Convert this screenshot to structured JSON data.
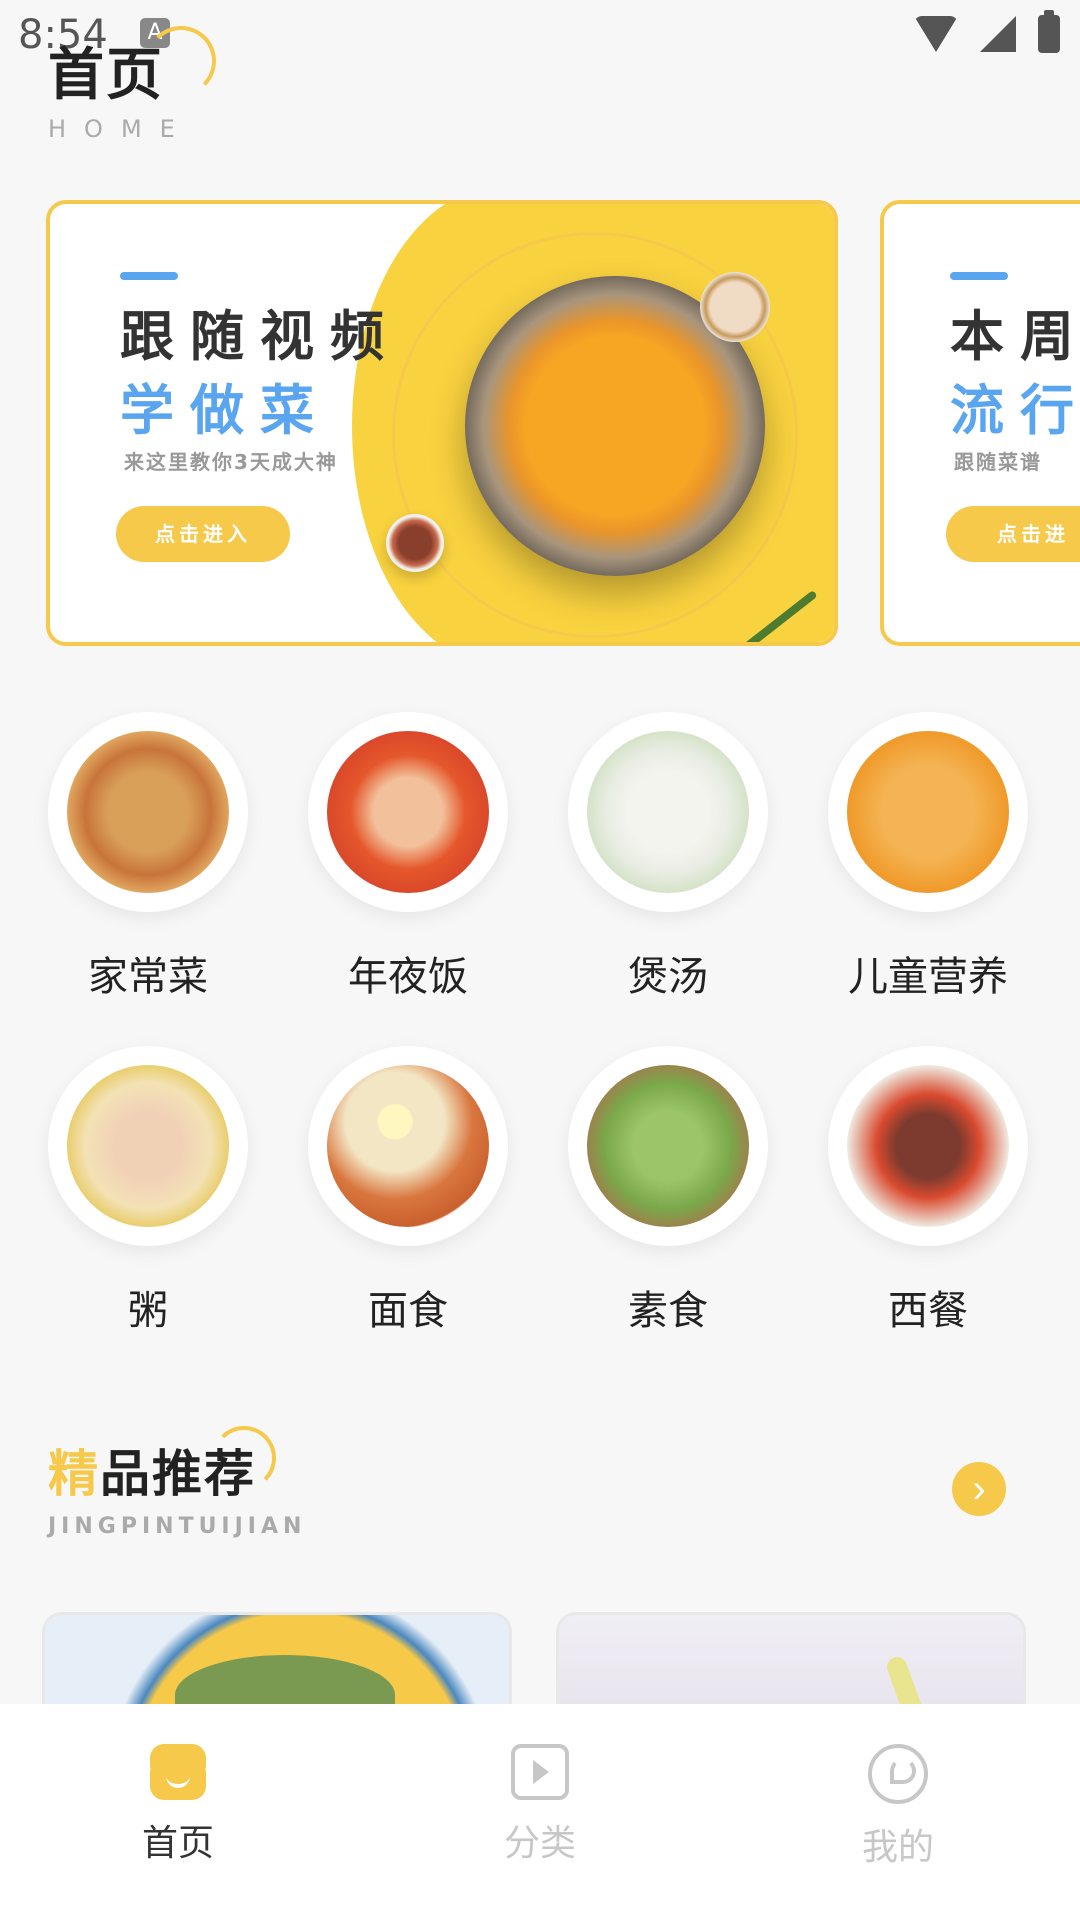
{
  "status_bar": {
    "time": "8:54",
    "notification_icon": "A"
  },
  "header": {
    "title": "首页",
    "subtitle": "HOME"
  },
  "banners": [
    {
      "line1": "跟随视频",
      "line2": "学做菜",
      "subtitle": "来这里教你3天成大神",
      "button": "点击进入"
    },
    {
      "line1": "本周",
      "line2": "流行",
      "subtitle": "跟随菜谱",
      "button": "点击进"
    }
  ],
  "categories": [
    {
      "label": "家常菜",
      "icon": "noodle-stirfry"
    },
    {
      "label": "年夜饭",
      "icon": "spicy-shrimp"
    },
    {
      "label": "煲汤",
      "icon": "white-soup"
    },
    {
      "label": "儿童营养",
      "icon": "pumpkin-soup"
    },
    {
      "label": "粥",
      "icon": "congee"
    },
    {
      "label": "面食",
      "icon": "ramen"
    },
    {
      "label": "素食",
      "icon": "salad"
    },
    {
      "label": "西餐",
      "icon": "steak"
    }
  ],
  "recommend": {
    "title_highlight": "精",
    "title_rest": "品推荐",
    "subtitle": "JINGPINTUIJIAN",
    "more_icon": "›"
  },
  "bottom_nav": [
    {
      "label": "首页",
      "icon": "chef-hat-icon",
      "active": true
    },
    {
      "label": "分类",
      "icon": "play-square-icon",
      "active": false
    },
    {
      "label": "我的",
      "icon": "profile-icon",
      "active": false
    }
  ],
  "colors": {
    "accent": "#f6c94b",
    "blue": "#5aa5ef",
    "inactive": "#c7c7c7"
  }
}
